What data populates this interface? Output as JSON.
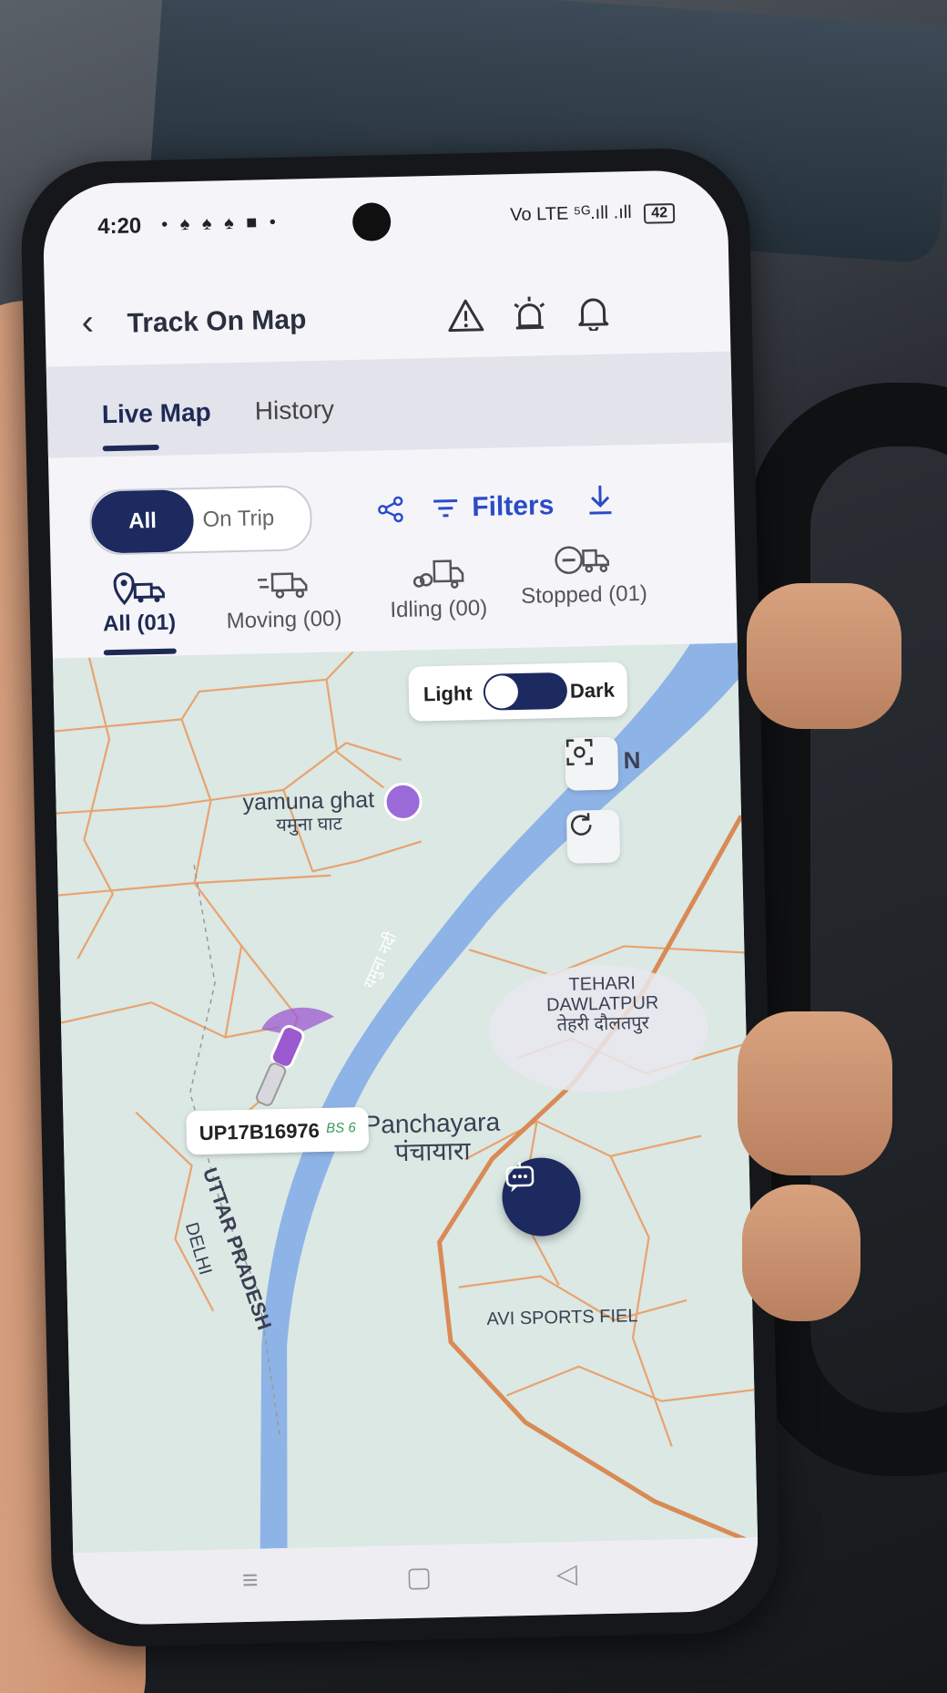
{
  "status_bar": {
    "time": "4:20",
    "notification_icons": "• ♠ ♠ ♠ ■ •",
    "signal": "Vo LTE ⁵ᴳ.ıll .ıll",
    "battery": "42"
  },
  "header": {
    "back_icon": "chevron-left-icon",
    "title": "Track On Map",
    "icons": [
      "warning-icon",
      "alarm-siren-icon",
      "bell-icon"
    ]
  },
  "tabs": [
    {
      "label": "Live Map",
      "active": true
    },
    {
      "label": "History",
      "active": false
    }
  ],
  "toolbar": {
    "segments": [
      "All",
      "On Trip"
    ],
    "selected_segment": "All",
    "share_icon": "share-icon",
    "filters_label": "Filters",
    "download_icon": "download-icon"
  },
  "categories": [
    {
      "label": "All (01)",
      "icon": "pin-truck-icon",
      "active": true
    },
    {
      "label": "Moving (00)",
      "icon": "moving-truck-icon",
      "active": false
    },
    {
      "label": "Idling (00)",
      "icon": "idling-truck-icon",
      "active": false
    },
    {
      "label": "Stopped (01)",
      "icon": "stopped-truck-icon",
      "active": false
    }
  ],
  "map": {
    "theme_toggle": {
      "left_label": "Light",
      "right_label": "Dark",
      "selected": "Dark"
    },
    "places": [
      {
        "name": "yamuna ghat",
        "local": "यमुना घाट"
      },
      {
        "name": "TEHARI DAWLATPUR",
        "local": "तेहरी दौलतपुर"
      },
      {
        "name": "Panchayara",
        "local": "पंचायारा"
      },
      {
        "name": "UTTAR PRADESH"
      },
      {
        "name": "DELHI"
      },
      {
        "name": "AVI SPORTS FIEL"
      },
      {
        "name": "यमुना नदी"
      },
      {
        "name": "N"
      }
    ],
    "vehicle": {
      "plate": "UP17B16976",
      "badge": "BS 6"
    },
    "colors": {
      "water": "#8eb3e6",
      "road": "#e8a36f",
      "land": "#dbe8e4",
      "accent": "#1d2a60",
      "vehicle": "#9b59d0"
    }
  },
  "chatbot_icon": "chatbot-icon",
  "nav_icons": [
    "menu-icon",
    "home-square-icon",
    "back-triangle-icon"
  ]
}
